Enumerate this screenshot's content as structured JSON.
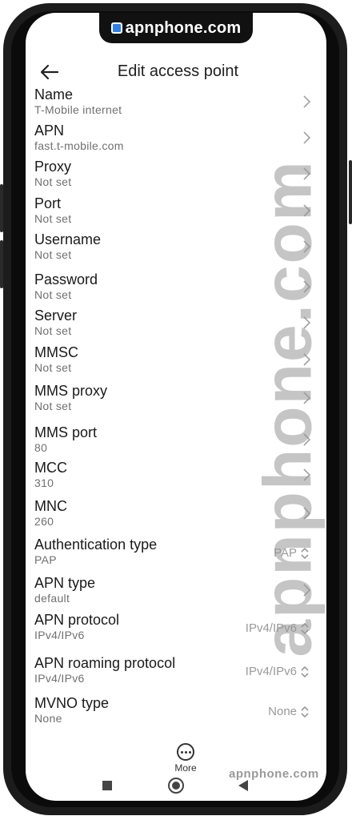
{
  "brand": {
    "logo_text": "apnphone.com",
    "watermark": "apnphone.com",
    "footer_watermark": "apnphone.com"
  },
  "header": {
    "title": "Edit access point"
  },
  "fields": [
    {
      "label": "Name",
      "value": "T-Mobile internet",
      "control": "chevron"
    },
    {
      "label": "APN",
      "value": "fast.t-mobile.com",
      "control": "chevron"
    },
    {
      "label": "Proxy",
      "value": "Not set",
      "control": "chevron"
    },
    {
      "label": "Port",
      "value": "Not set",
      "control": "chevron"
    },
    {
      "label": "Username",
      "value": "Not set",
      "control": "chevron"
    },
    {
      "label": "Password",
      "value": "Not set",
      "control": "chevron"
    },
    {
      "label": "Server",
      "value": "Not set",
      "control": "chevron"
    },
    {
      "label": "MMSC",
      "value": "Not set",
      "control": "chevron"
    },
    {
      "label": "MMS proxy",
      "value": "Not set",
      "control": "chevron"
    },
    {
      "label": "MMS port",
      "value": "80",
      "control": "chevron"
    },
    {
      "label": "MCC",
      "value": "310",
      "control": "chevron"
    },
    {
      "label": "MNC",
      "value": "260",
      "control": "chevron"
    },
    {
      "label": "Authentication type",
      "value": "PAP",
      "control": "select",
      "selected": "PAP"
    },
    {
      "label": "APN type",
      "value": "default",
      "control": "chevron"
    },
    {
      "label": "APN protocol",
      "value": "IPv4/IPv6",
      "control": "select",
      "selected": "IPv4/IPv6"
    },
    {
      "label": "APN roaming protocol",
      "value": "IPv4/IPv6",
      "control": "select",
      "selected": "IPv4/IPv6"
    },
    {
      "label": "MVNO type",
      "value": "None",
      "control": "select",
      "selected": "None"
    }
  ],
  "bottom": {
    "more_label": "More"
  },
  "icons": {
    "back": "back-arrow-icon",
    "more": "more-icon",
    "chevron": "chevron-right-icon",
    "select": "select-arrows-icon"
  },
  "colors": {
    "logo_accent": "#2f7fe8"
  }
}
